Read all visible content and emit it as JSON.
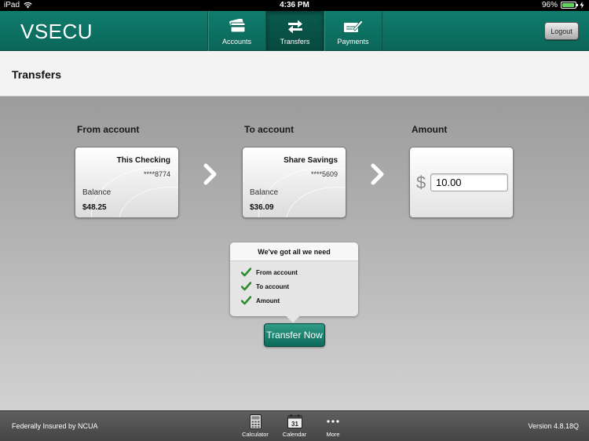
{
  "status_bar": {
    "device": "iPad",
    "time": "4:36 PM",
    "battery_text": "96%",
    "battery_level": 0.96
  },
  "header": {
    "logo": "VSECU",
    "nav": [
      {
        "label": "Accounts",
        "icon": "accounts-card-icon",
        "active": false
      },
      {
        "label": "Transfers",
        "icon": "transfer-arrows-icon",
        "active": true
      },
      {
        "label": "Payments",
        "icon": "check-pen-icon",
        "active": false
      }
    ],
    "logout_label": "Logout"
  },
  "page": {
    "title": "Transfers"
  },
  "transfer": {
    "from_label": "From account",
    "to_label": "To account",
    "amount_label": "Amount",
    "from_account": {
      "name": "This Checking",
      "number": "****8774",
      "balance_label": "Balance",
      "balance": "$48.25"
    },
    "to_account": {
      "name": "Share Savings",
      "number": "****5609",
      "balance_label": "Balance",
      "balance": "$36.09"
    },
    "currency_symbol": "$",
    "amount_value": "10.00"
  },
  "checklist": {
    "title": "We've got all we need",
    "items": [
      "From account",
      "To account",
      "Amount"
    ]
  },
  "transfer_button_label": "Transfer Now",
  "footer": {
    "insured_text": "Federally Insured by NCUA",
    "tools": [
      {
        "label": "Calculator",
        "icon": "calculator-icon"
      },
      {
        "label": "Calendar",
        "icon": "calendar-icon",
        "day": "31"
      },
      {
        "label": "More",
        "icon": "more-dots-icon"
      }
    ],
    "version": "Version 4.8.18Q"
  },
  "colors": {
    "brand_green": "#0f7d6d",
    "check_green": "#2e8b2e"
  }
}
